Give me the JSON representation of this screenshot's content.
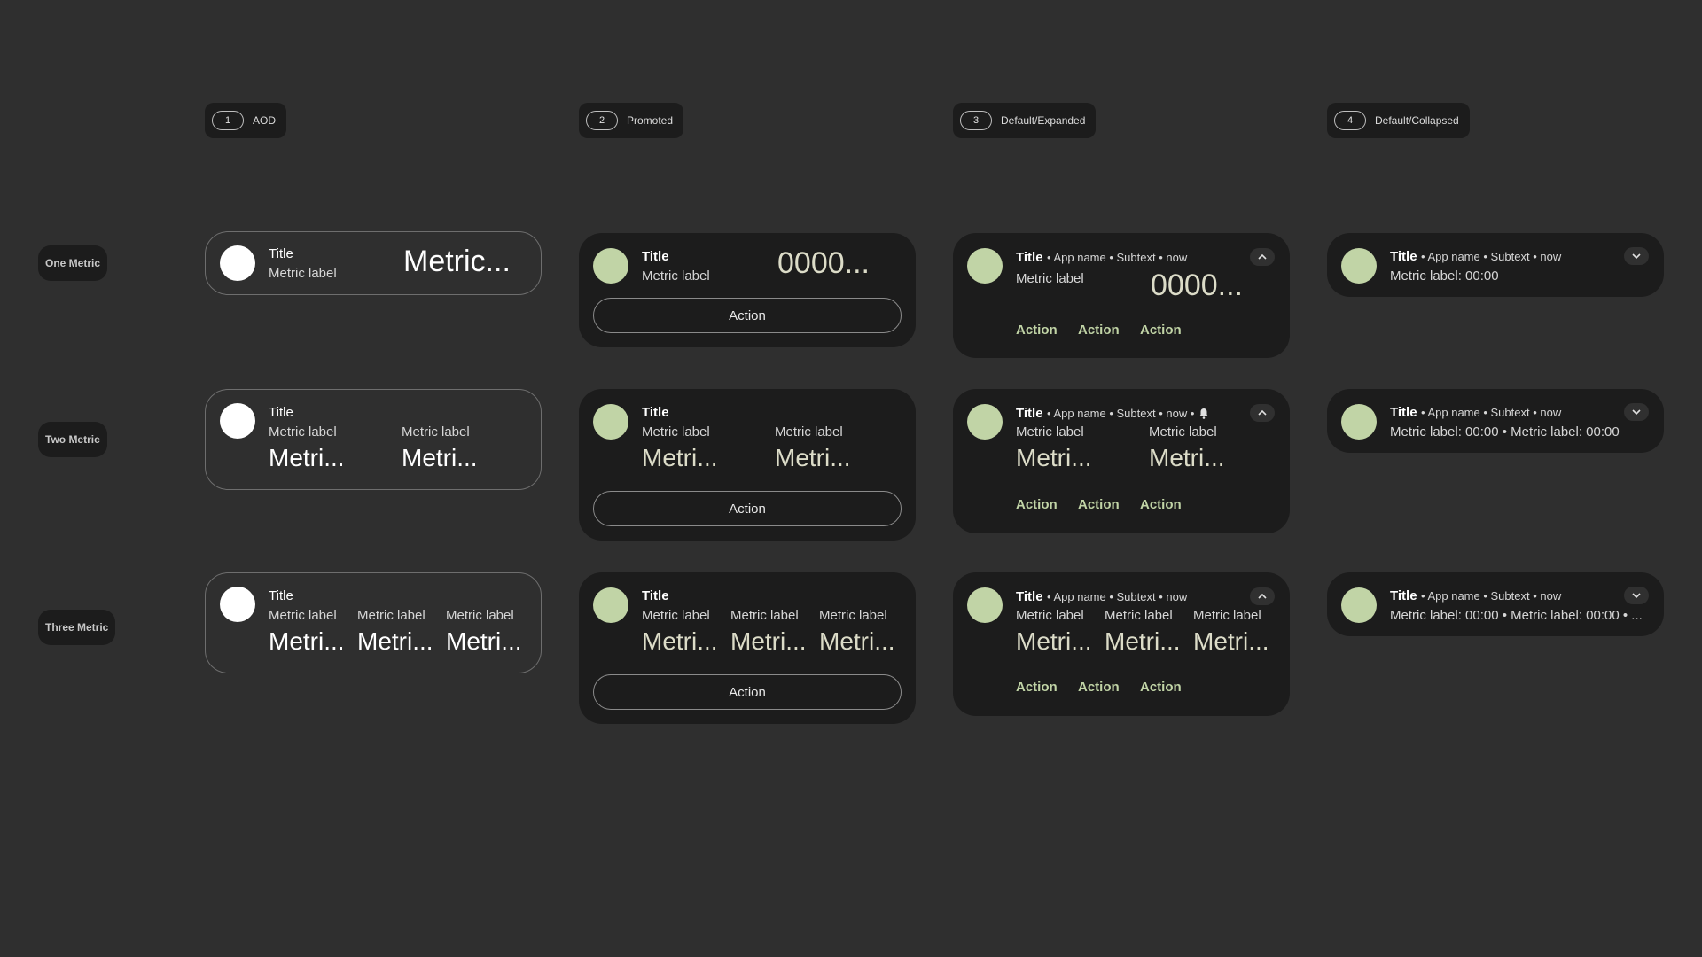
{
  "columns": [
    {
      "num": "1",
      "label": "AOD"
    },
    {
      "num": "2",
      "label": "Promoted"
    },
    {
      "num": "3",
      "label": "Default/Expanded"
    },
    {
      "num": "4",
      "label": "Default/Collapsed"
    }
  ],
  "rows": [
    "One Metric",
    "Two Metric",
    "Three Metric"
  ],
  "text": {
    "title": "Title",
    "metric_label": "Metric label",
    "action": "Action",
    "header_meta": "• App name • Subtext • now",
    "header_meta_bell": "• App name • Subtext • now •",
    "one_aod_value": "Metric...",
    "one_value": "0000...",
    "short_value": "Metri...",
    "collapsed_one": "Metric label: 00:00",
    "collapsed_two": "Metric label: 00:00 • Metric label: 00:00",
    "collapsed_three": "Metric label: 00:00 • Metric label: 00:00 • ..."
  },
  "icons": {
    "expand": "chevron-up-icon",
    "collapse": "chevron-down-icon",
    "alert": "bell-icon"
  },
  "colors": {
    "background": "#2f2f2f",
    "card": "#1c1c1c",
    "accent": "#c1d4a6",
    "aod_avatar": "#ffffff"
  }
}
